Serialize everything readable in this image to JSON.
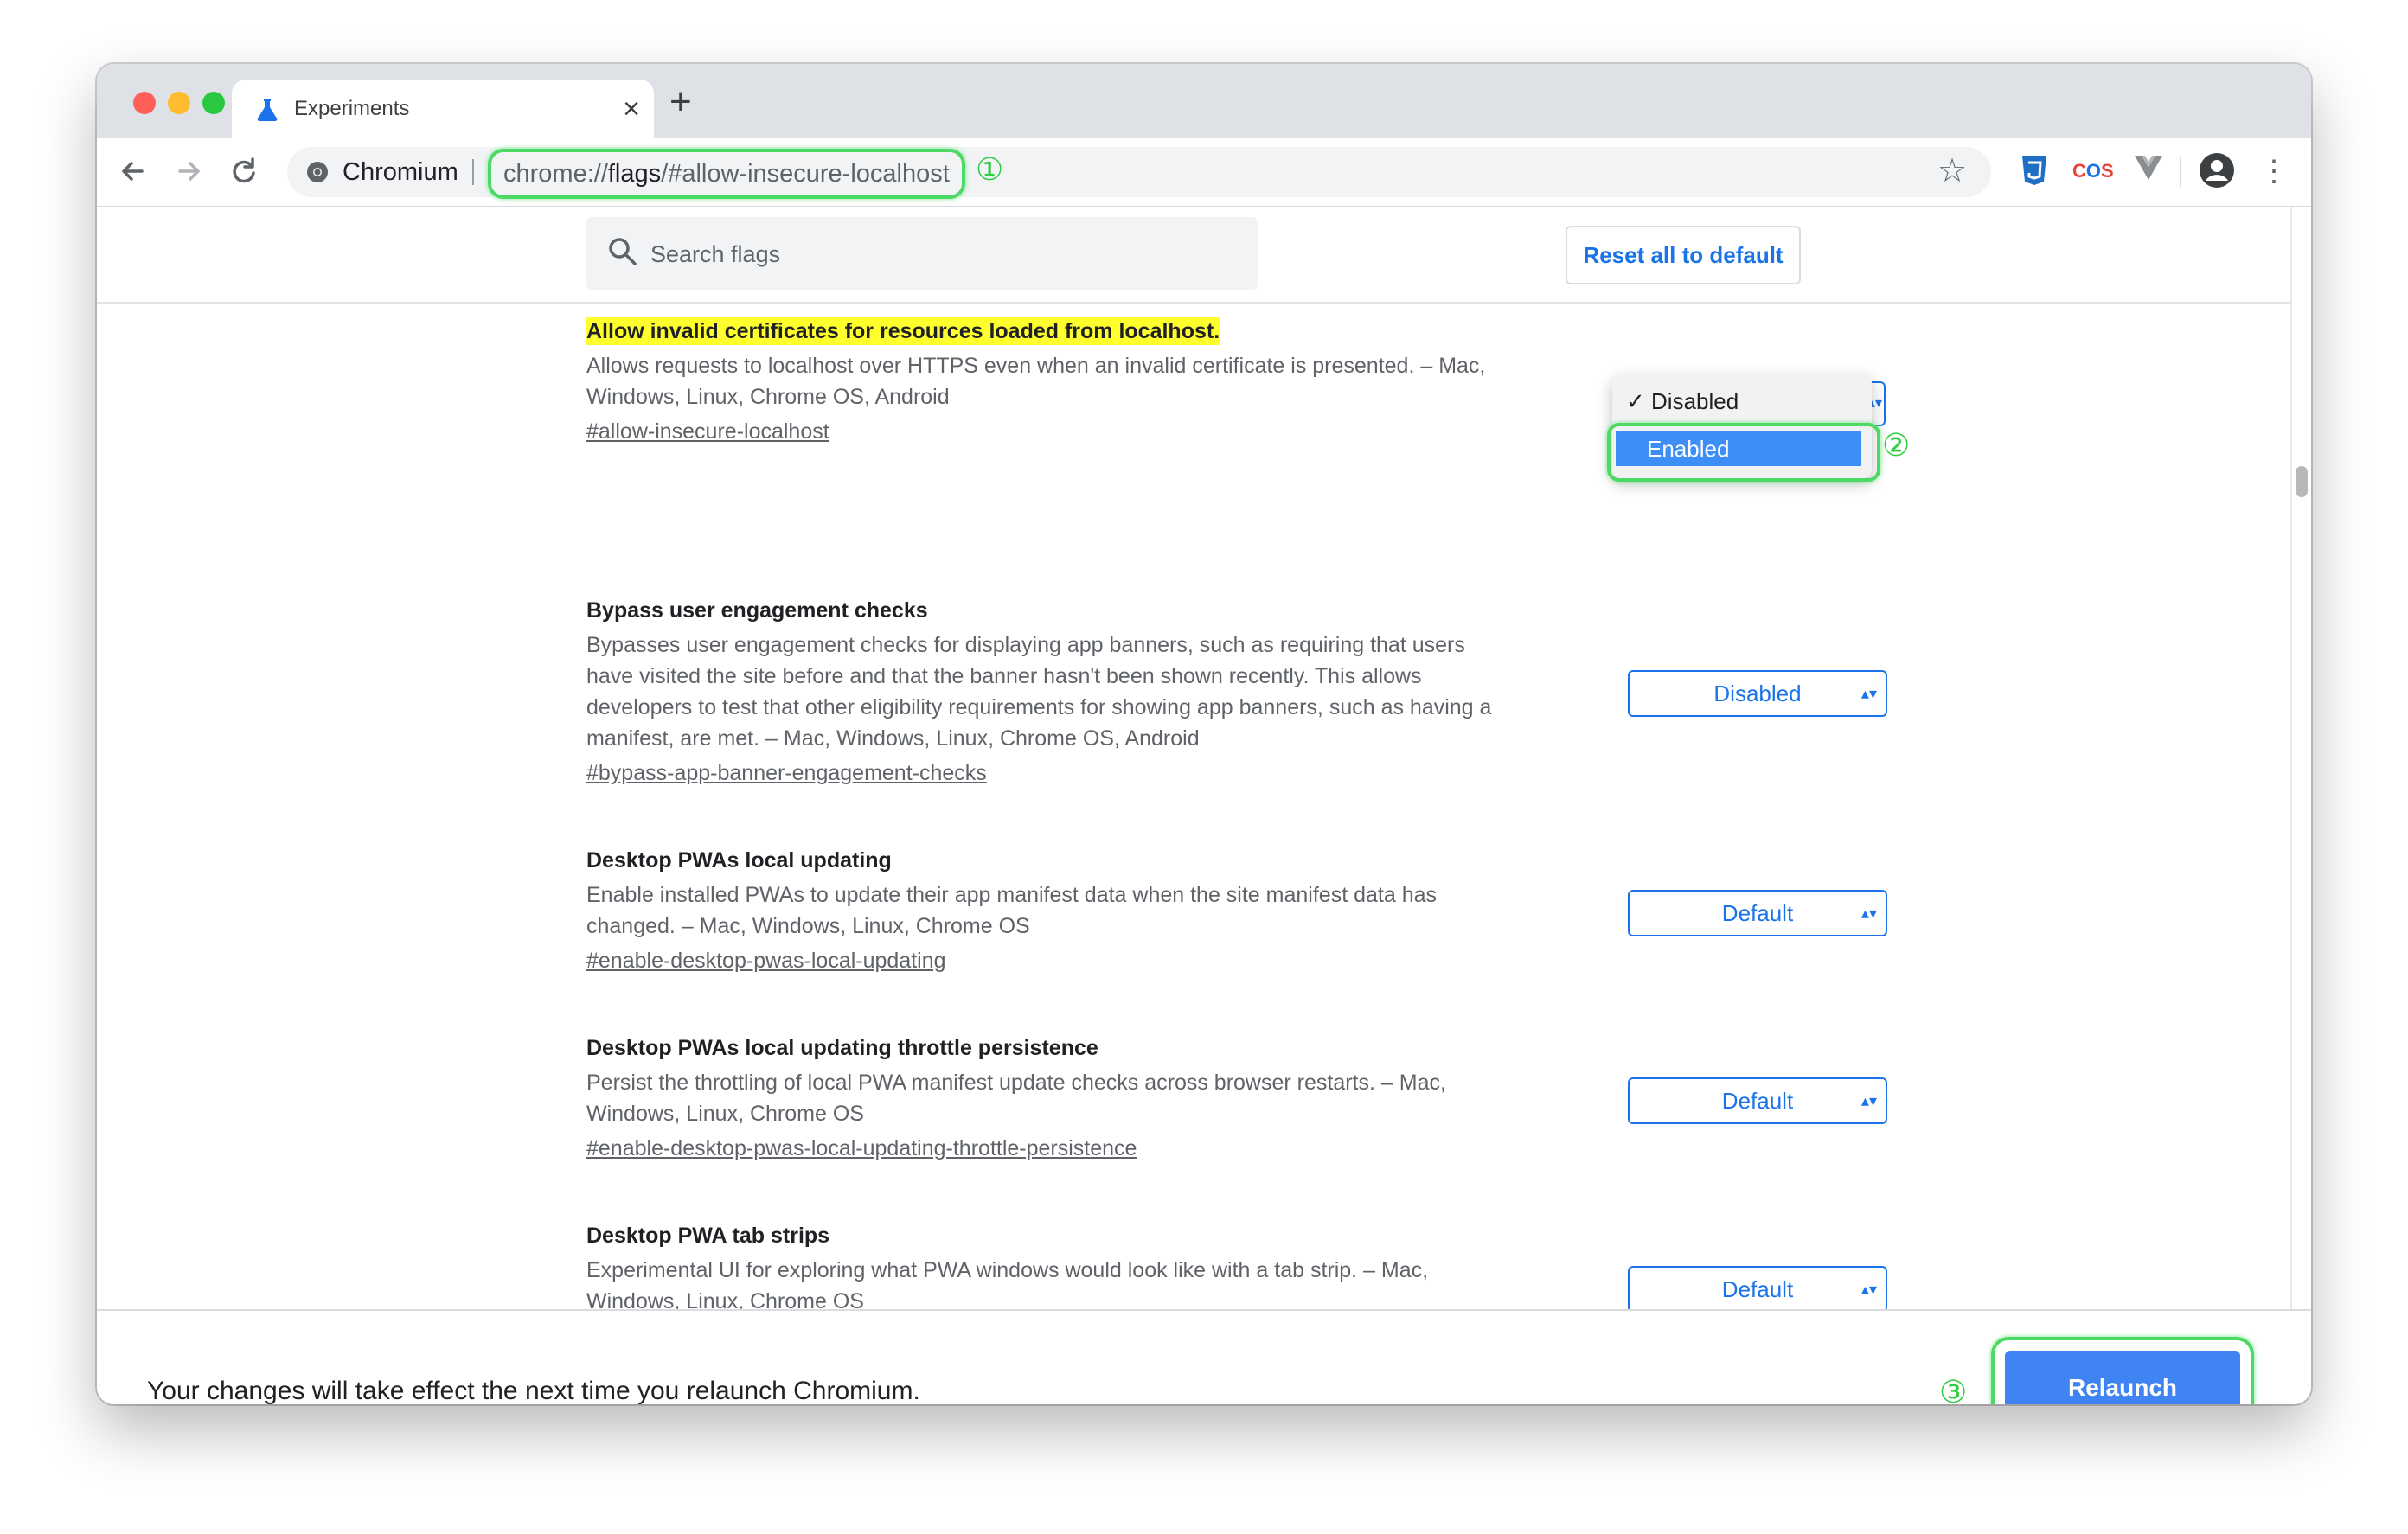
{
  "browser": {
    "tab_title": "Experiments",
    "tab_close": "×",
    "new_tab": "+",
    "site_name": "Chromium",
    "url_prefix": "chrome://",
    "url_host": "flags",
    "url_suffix": "/#allow-insecure-localhost",
    "markers": {
      "one": "①",
      "two": "②",
      "three": "③"
    },
    "extensions": [
      "css-ext-icon",
      "cors-ext-icon",
      "vue-ext-icon"
    ]
  },
  "header": {
    "search_placeholder": "Search flags",
    "reset_label": "Reset all to default"
  },
  "flags": [
    {
      "title": "Allow invalid certificates for resources loaded from localhost.",
      "desc": "Allows requests to localhost over HTTPS even when an invalid certificate is presented. – Mac, Windows, Linux, Chrome OS, Android",
      "link": "#allow-insecure-localhost",
      "value": "Disabled",
      "options": [
        "Disabled",
        "Enabled"
      ],
      "highlighted_option": "Enabled"
    },
    {
      "title": "Bypass user engagement checks",
      "desc": "Bypasses user engagement checks for displaying app banners, such as requiring that users have visited the site before and that the banner hasn't been shown recently. This allows developers to test that other eligibility requirements for showing app banners, such as having a manifest, are met. – Mac, Windows, Linux, Chrome OS, Android",
      "link": "#bypass-app-banner-engagement-checks",
      "value": "Disabled"
    },
    {
      "title": "Desktop PWAs local updating",
      "desc": "Enable installed PWAs to update their app manifest data when the site manifest data has changed. – Mac, Windows, Linux, Chrome OS",
      "link": "#enable-desktop-pwas-local-updating",
      "value": "Default"
    },
    {
      "title": "Desktop PWAs local updating throttle persistence",
      "desc": "Persist the throttling of local PWA manifest update checks across browser restarts. – Mac, Windows, Linux, Chrome OS",
      "link": "#enable-desktop-pwas-local-updating-throttle-persistence",
      "value": "Default"
    },
    {
      "title": "Desktop PWA tab strips",
      "desc": "Experimental UI for exploring what PWA windows would look like with a tab strip. – Mac, Windows, Linux, Chrome OS",
      "link": "",
      "value": "Default"
    }
  ],
  "bottom": {
    "message": "Your changes will take effect the next time you relaunch Chromium.",
    "relaunch_label": "Relaunch"
  },
  "colors": {
    "accent": "#1a73e8",
    "highlight": "#ffff2e",
    "annotation": "#4cd964",
    "relaunch": "#3f84f2"
  }
}
